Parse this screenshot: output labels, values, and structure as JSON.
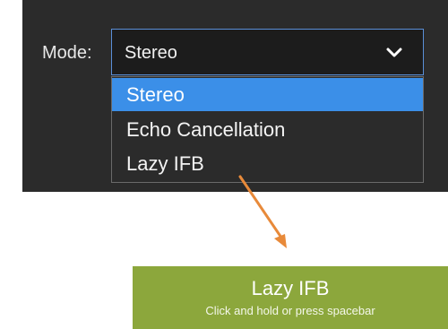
{
  "mode": {
    "label": "Mode:",
    "selected_value": "Stereo",
    "options": [
      {
        "label": "Stereo",
        "highlighted": true
      },
      {
        "label": "Echo Cancellation",
        "highlighted": false
      },
      {
        "label": "Lazy IFB",
        "highlighted": false
      }
    ],
    "icon": "chevron-down-icon"
  },
  "ifb_button": {
    "title": "Lazy IFB",
    "subtitle": "Click and hold or press spacebar"
  },
  "colors": {
    "panel_bg": "#2b2b2b",
    "highlight": "#3b8fe8",
    "arrow": "#e88a3a",
    "button_bg": "#8ca73c"
  }
}
